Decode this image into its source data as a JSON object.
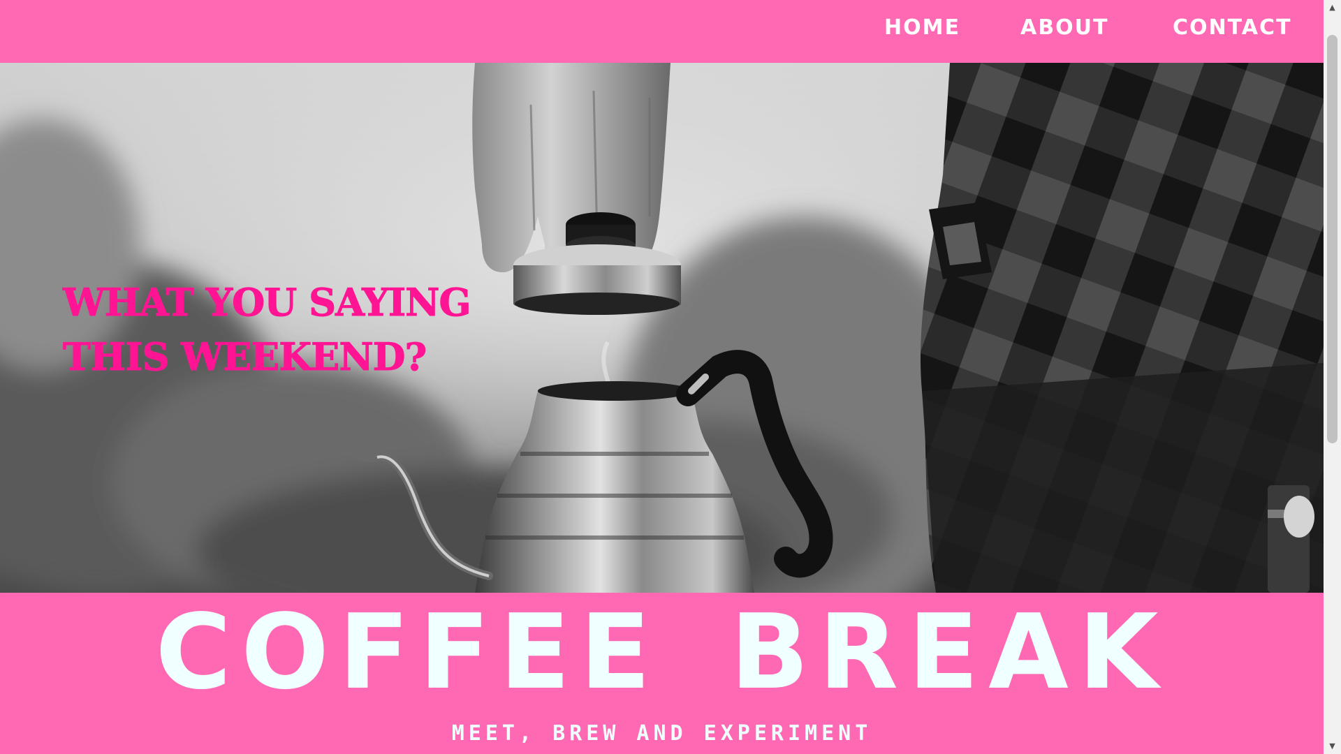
{
  "nav": {
    "items": [
      {
        "label": "HOME"
      },
      {
        "label": "ABOUT"
      },
      {
        "label": "CONTACT"
      }
    ]
  },
  "hero": {
    "headline_line1": "WHAT YOU SAYING",
    "headline_line2": "THIS WEEKEND?",
    "image_subject": "kettle-pour-over-photo"
  },
  "brand": {
    "word1": "COFFEE",
    "word2": "BREAK",
    "tagline": "MEET, BREW AND EXPERIMENT"
  },
  "scrollbar": {
    "up_icon": "arrow-up-icon",
    "down_icon": "arrow-down-icon"
  },
  "colors": {
    "accent_pink": "#ff69b4",
    "headline_pink": "#ff1493",
    "brand_text": "#f0ffff"
  }
}
